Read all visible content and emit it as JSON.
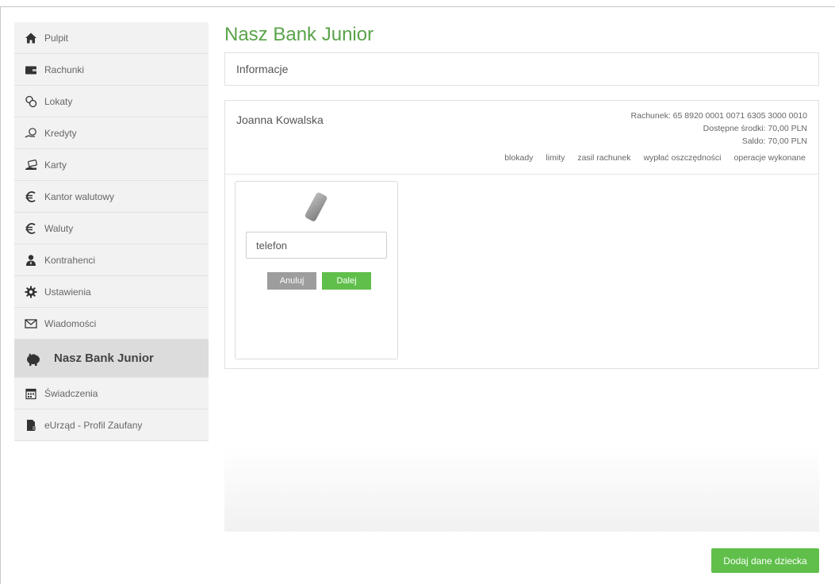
{
  "sidebar": {
    "items": [
      {
        "label": "Pulpit",
        "icon": "home-icon"
      },
      {
        "label": "Rachunki",
        "icon": "wallet-icon"
      },
      {
        "label": "Lokaty",
        "icon": "coins-icon"
      },
      {
        "label": "Kredyty",
        "icon": "hand-coins-icon"
      },
      {
        "label": "Karty",
        "icon": "card-hand-icon"
      },
      {
        "label": "Kantor walutowy",
        "icon": "euro-icon"
      },
      {
        "label": "Waluty",
        "icon": "euro-icon"
      },
      {
        "label": "Kontrahenci",
        "icon": "person-icon"
      },
      {
        "label": "Ustawienia",
        "icon": "gear-icon"
      },
      {
        "label": "Wiadomości",
        "icon": "envelope-icon"
      },
      {
        "label": "Nasz Bank Junior",
        "icon": "piggy-bank-icon",
        "active": true
      },
      {
        "label": "Świadczenia",
        "icon": "calendar-icon"
      },
      {
        "label": "eUrząd - Profil Zaufany",
        "icon": "document-icon"
      }
    ]
  },
  "main": {
    "title": "Nasz Bank Junior",
    "info_label": "Informacje",
    "account": {
      "owner": "Joanna Kowalska",
      "number_line": "Rachunek: 65 8920 0001 0071 6305 3000 0010",
      "available_line": "Dostępne środki: 70,00 PLN",
      "balance_line": "Saldo: 70,00 PLN",
      "links": [
        "blokady",
        "limity",
        "zasil rachunek",
        "wypłać oszczędności",
        "operacje wykonane"
      ]
    },
    "phone_form": {
      "input_value": "telefon",
      "cancel_label": "Anuluj",
      "next_label": "Dalej"
    },
    "add_child_label": "Dodaj dane dziecka"
  },
  "colors": {
    "accent_green": "#5fbf4a",
    "title_green": "#5aa34a",
    "cancel_gray": "#9d9d9d",
    "sidebar_bg": "#f2f2f2",
    "sidebar_active_bg": "#dcdcdc"
  }
}
